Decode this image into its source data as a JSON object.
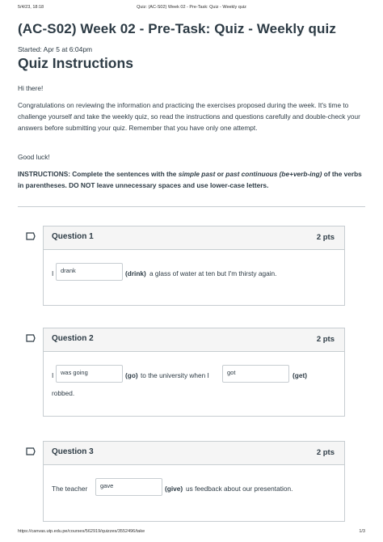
{
  "print": {
    "datetime": "5/4/23, 18:18",
    "doc_title": "Quiz: (AC-S02) Week 02 - Pre-Task: Quiz - Weekly quiz",
    "url": "https://canvas.utp.edu.pe/courses/562919/quizzes/3552496/take",
    "page_number": "1/3"
  },
  "quiz": {
    "title": "(AC-S02) Week 02 - Pre-Task: Quiz - Weekly quiz",
    "started": "Started: Apr 5 at 6:04pm",
    "instructions_heading": "Quiz Instructions",
    "greeting": "Hi there!",
    "intro": "Congratulations on reviewing the information and practicing the exercises proposed during the week. It's time to challenge yourself and take the weekly quiz, so read the instructions and questions carefully and double-check your answers before submitting your quiz. Remember that you have only one attempt.",
    "good_luck": "Good luck!",
    "instructions": {
      "label": "INSTRUCTIONS:",
      "part1": " Complete the sentences with the ",
      "em1": "simple past",
      "part2": " or ",
      "em2": "past continuous (be+verb-ing)",
      "part3": " of the verbs in parentheses. DO NOT leave unnecessary spaces and use lower-case letters."
    }
  },
  "questions": [
    {
      "name": "Question 1",
      "points": "2 pts",
      "t1": "I",
      "a1": "drank",
      "v1": "(drink)",
      "t2": " a glass of water at ten but I'm thirsty again."
    },
    {
      "name": "Question 2",
      "points": "2 pts",
      "t1": "I",
      "a1": "was going",
      "v1": "(go)",
      "t2": "to the university when I",
      "a2": "got",
      "v2": "(get)",
      "t3": "robbed."
    },
    {
      "name": "Question 3",
      "points": "2 pts",
      "t1": "The teacher",
      "a1": "gave",
      "v1": "(give)",
      "t2": " us feedback about our presentation."
    }
  ],
  "colors": {
    "text": "#2d3b45",
    "border": "#c7cdd1",
    "header_bg": "#f5f5f5",
    "flag": "#2d3b45"
  },
  "icons": {
    "flag": "flag-question-icon"
  }
}
